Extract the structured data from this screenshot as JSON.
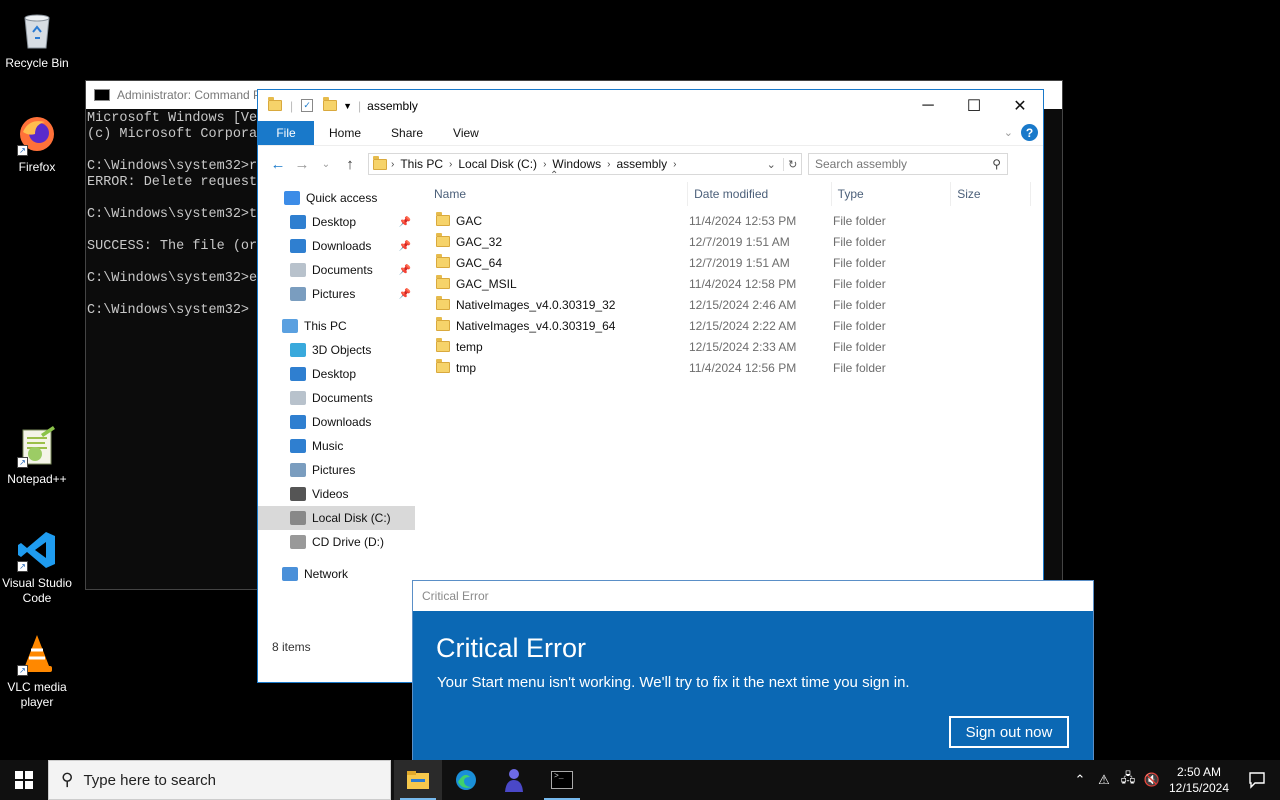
{
  "desktop": {
    "icons": [
      {
        "label": "Recycle Bin",
        "icon": "recycle-bin-icon"
      },
      {
        "label": "Firefox",
        "icon": "firefox-icon"
      },
      {
        "label": "Notepad++",
        "icon": "notepadpp-icon"
      },
      {
        "label": "Visual Studio Code",
        "icon": "vscode-icon"
      },
      {
        "label": "VLC media player",
        "icon": "vlc-icon"
      }
    ]
  },
  "cmd": {
    "title": "Administrator: Command P",
    "lines": [
      "Microsoft Windows [Ve",
      "(c) Microsoft Corpora",
      "",
      "C:\\Windows\\system32>r",
      "ERROR: Delete request",
      "",
      "C:\\Windows\\system32>t",
      "",
      "SUCCESS: The file (or",
      "",
      "C:\\Windows\\system32>e",
      "",
      "C:\\Windows\\system32>"
    ]
  },
  "explorer": {
    "title": "assembly",
    "ribbon": {
      "file": "File",
      "home": "Home",
      "share": "Share",
      "view": "View"
    },
    "breadcrumb": [
      "This PC",
      "Local Disk (C:)",
      "Windows",
      "assembly"
    ],
    "search_placeholder": "Search assembly",
    "columns": {
      "name": "Name",
      "date": "Date modified",
      "type": "Type",
      "size": "Size"
    },
    "nav": {
      "quick_access": "Quick access",
      "qa_items": [
        "Desktop",
        "Downloads",
        "Documents",
        "Pictures"
      ],
      "this_pc": "This PC",
      "pc_items": [
        "3D Objects",
        "Desktop",
        "Documents",
        "Downloads",
        "Music",
        "Pictures",
        "Videos",
        "Local Disk (C:)",
        "CD Drive (D:)"
      ],
      "network": "Network"
    },
    "files": [
      {
        "name": "GAC",
        "date": "11/4/2024 12:53 PM",
        "type": "File folder"
      },
      {
        "name": "GAC_32",
        "date": "12/7/2019 1:51 AM",
        "type": "File folder"
      },
      {
        "name": "GAC_64",
        "date": "12/7/2019 1:51 AM",
        "type": "File folder"
      },
      {
        "name": "GAC_MSIL",
        "date": "11/4/2024 12:58 PM",
        "type": "File folder"
      },
      {
        "name": "NativeImages_v4.0.30319_32",
        "date": "12/15/2024 2:46 AM",
        "type": "File folder"
      },
      {
        "name": "NativeImages_v4.0.30319_64",
        "date": "12/15/2024 2:22 AM",
        "type": "File folder"
      },
      {
        "name": "temp",
        "date": "12/15/2024 2:33 AM",
        "type": "File folder"
      },
      {
        "name": "tmp",
        "date": "11/4/2024 12:56 PM",
        "type": "File folder"
      }
    ],
    "status": "8 items"
  },
  "critical": {
    "window_title": "Critical Error",
    "heading": "Critical Error",
    "message": "Your Start menu isn't working. We'll try to fix it the next time you sign in.",
    "button": "Sign out now"
  },
  "taskbar": {
    "search_placeholder": "Type here to search",
    "time": "2:50 AM",
    "date": "12/15/2024"
  },
  "colors": {
    "accent": "#1979ca",
    "dialog_blue": "#0b68b4",
    "taskbar": "#101010"
  }
}
